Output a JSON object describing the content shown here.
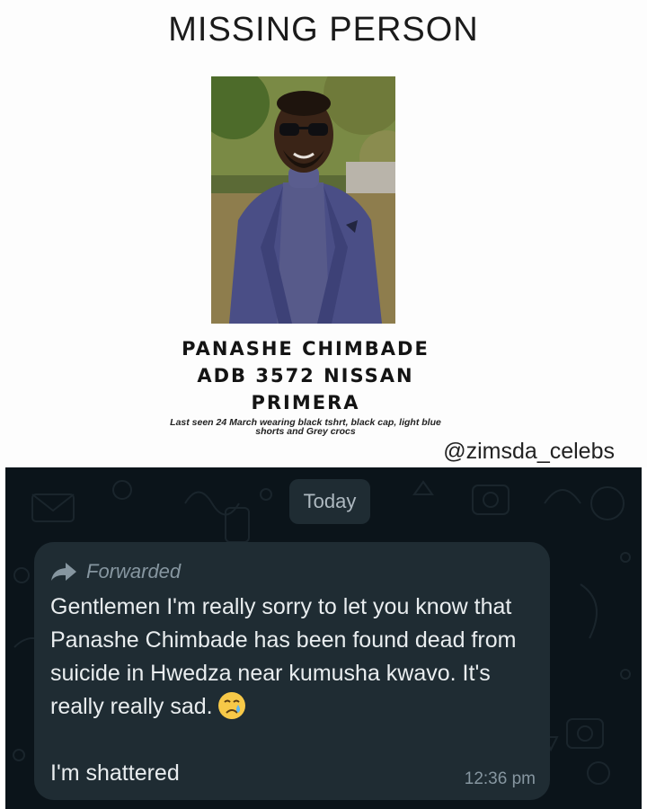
{
  "poster": {
    "title": "MISSING PERSON",
    "name_line1": "PANASHE CHIMBADE",
    "name_line2": "ADB 3572 NISSAN",
    "name_line3": "PRIMERA",
    "last_seen_line1": "Last seen 24 March wearing black tshrt, black cap, light blue",
    "last_seen_line2": "shorts and Grey crocs",
    "watermark": "@zimsda_celebs"
  },
  "chat": {
    "date_chip": "Today",
    "message": {
      "forwarded_label": "Forwarded",
      "text": "Gentlemen I'm really sorry to let you know that Panashe Chimbade has been found dead from suicide in Hwedza near kumusha kwavo. It's really really sad.",
      "emoji": "crying-face-icon",
      "text_after": "I'm shattered",
      "time": "12:36 pm"
    }
  },
  "colors": {
    "chat_background": "#0b141a",
    "bubble": "#1f2c33",
    "meta_text": "#8696a0",
    "message_text": "#e9edef"
  }
}
